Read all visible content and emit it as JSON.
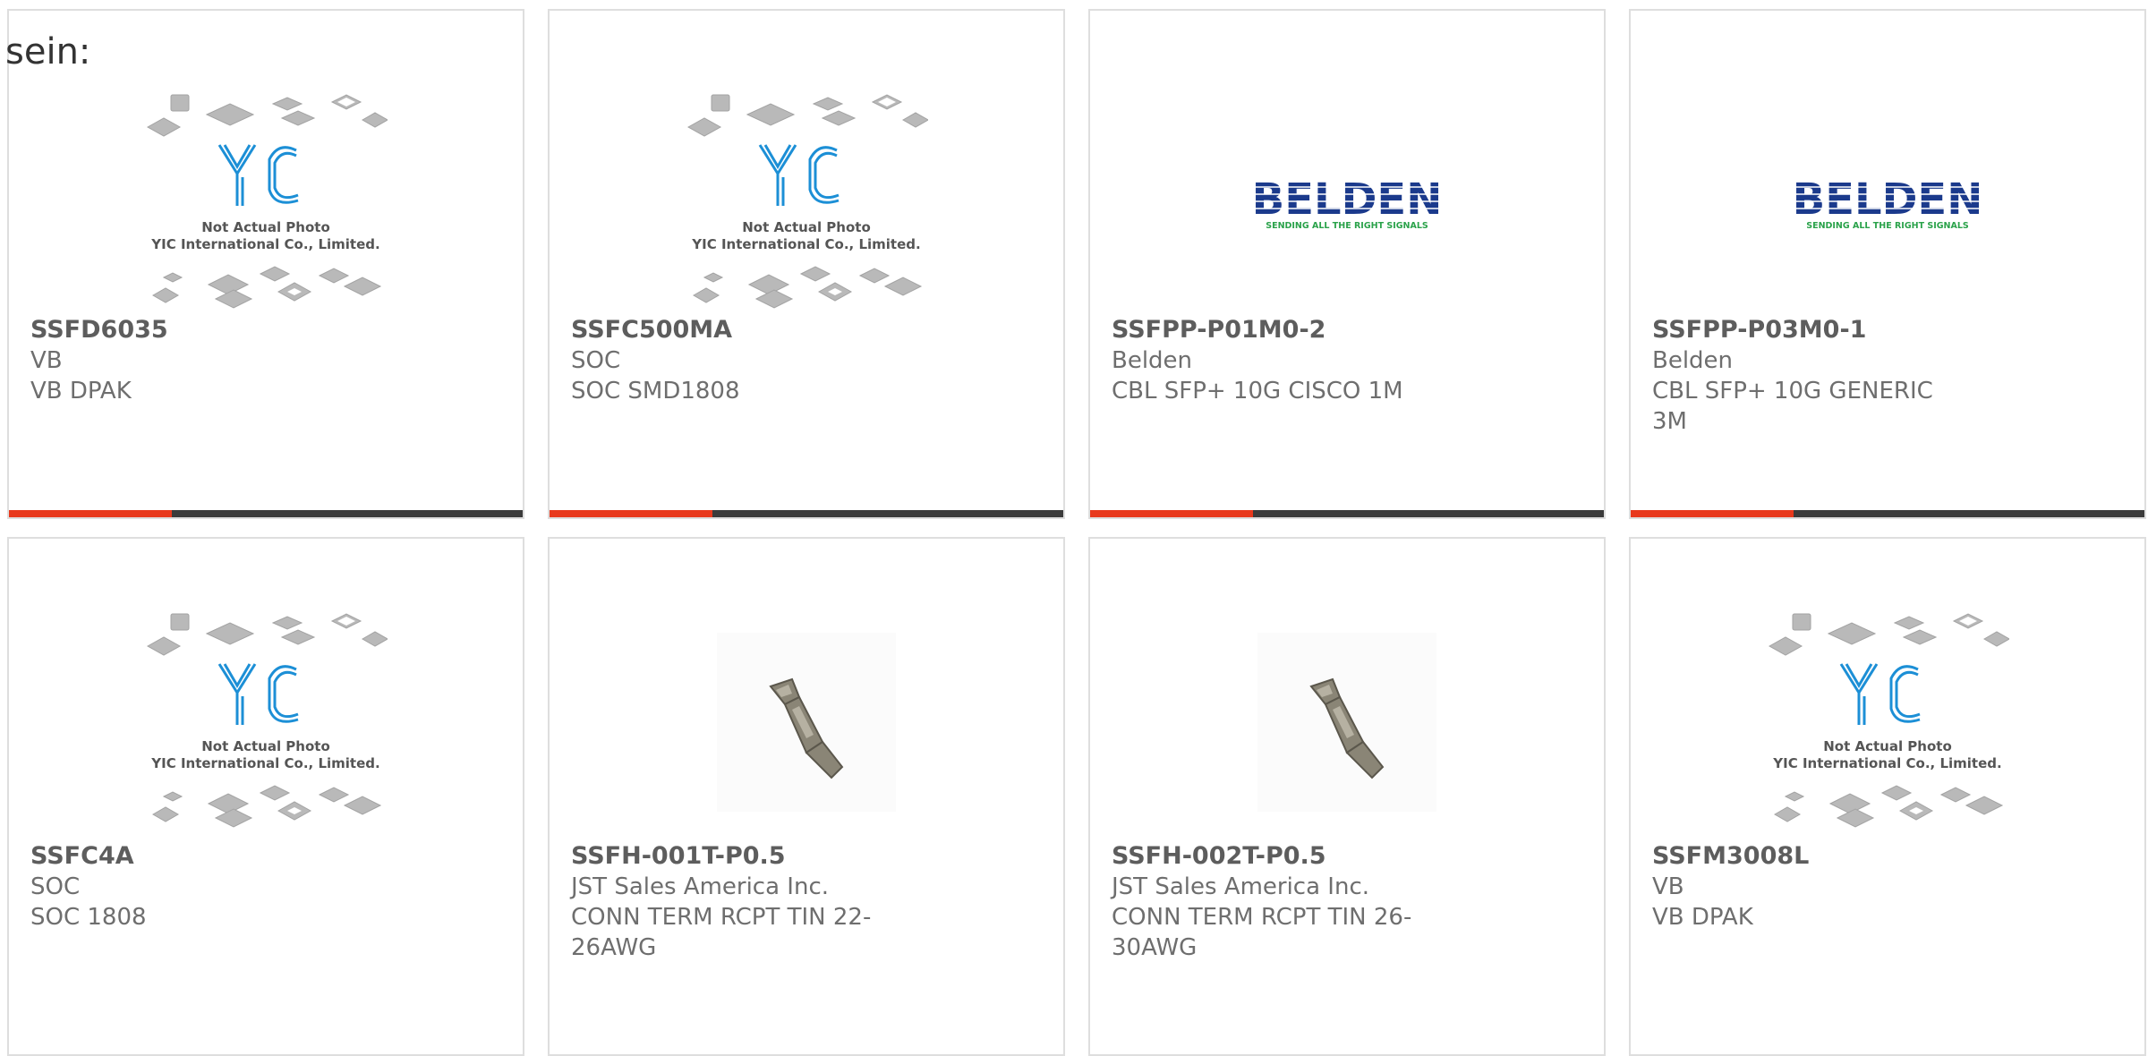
{
  "intro_text": "sein:",
  "colors": {
    "accent": "#e8391d",
    "bar": "#3b3b3b",
    "belden_blue": "#1b3a8c",
    "belden_green": "#2aa24a",
    "yic_blue": "#1c8fd6"
  },
  "yic_placeholder": {
    "line1": "Not Actual Photo",
    "line2": "YIC International Co., Limited."
  },
  "belden_logo": {
    "name": "BELDEN",
    "tagline": "SENDING ALL THE RIGHT SIGNALS"
  },
  "products": [
    {
      "part": "SSFD6035",
      "manufacturer": "VB",
      "description": "VB DPAK",
      "image": "yic-placeholder"
    },
    {
      "part": "SSFC500MA",
      "manufacturer": "SOC",
      "description": "SOC SMD1808",
      "image": "yic-placeholder"
    },
    {
      "part": "SSFPP-P01M0-2",
      "manufacturer": "Belden",
      "description": "CBL SFP+ 10G CISCO 1M",
      "image": "belden-logo"
    },
    {
      "part": "SSFPP-P03M0-1",
      "manufacturer": "Belden",
      "description": "CBL SFP+ 10G GENERIC 3M",
      "image": "belden-logo"
    },
    {
      "part": "SSFC4A",
      "manufacturer": "SOC",
      "description": "SOC 1808",
      "image": "yic-placeholder"
    },
    {
      "part": "SSFH-001T-P0.5",
      "manufacturer": "JST Sales America Inc.",
      "description": "CONN TERM RCPT TIN 22-26AWG",
      "image": "crimp-terminal-photo"
    },
    {
      "part": "SSFH-002T-P0.5",
      "manufacturer": "JST Sales America Inc.",
      "description": "CONN TERM RCPT TIN 26-30AWG",
      "image": "crimp-terminal-photo"
    },
    {
      "part": "SSFM3008L",
      "manufacturer": "VB",
      "description": "VB DPAK",
      "image": "yic-placeholder"
    }
  ]
}
